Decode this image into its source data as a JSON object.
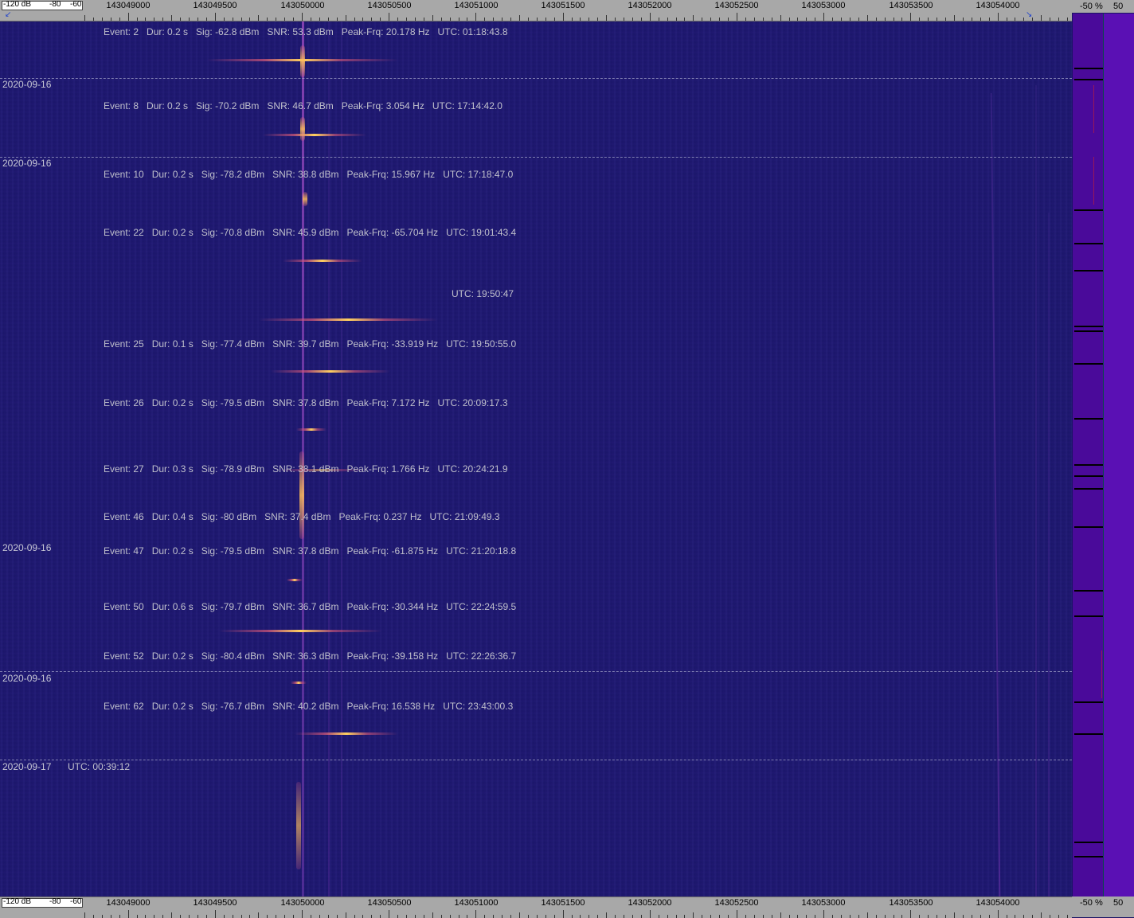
{
  "ruler": {
    "db_labels": [
      "-120 dB",
      "-80",
      "-60"
    ],
    "freqs": [
      "143049000",
      "143049500",
      "143050000",
      "143050500",
      "143051000",
      "143051500",
      "143052000",
      "143052500",
      "143053000",
      "143053500",
      "143054000"
    ]
  },
  "right_ruler": {
    "pct": "-50 %",
    "val": "50"
  },
  "dates": [
    {
      "text": "2020-09-16"
    },
    {
      "text": "2020-09-16"
    },
    {
      "text": "2020-09-16"
    },
    {
      "text": "2020-09-16"
    },
    {
      "text": "2020-09-17"
    }
  ],
  "events": [
    "Event: 2   Dur: 0.2 s   Sig: -62.8 dBm   SNR: 53.3 dBm   Peak-Frq: 20.178 Hz   UTC: 01:18:43.8",
    "Event: 8   Dur: 0.2 s   Sig: -70.2 dBm   SNR: 46.7 dBm   Peak-Frq: 3.054 Hz   UTC: 17:14:42.0",
    "Event: 10   Dur: 0.2 s   Sig: -78.2 dBm   SNR: 38.8 dBm   Peak-Frq: 15.967 Hz   UTC: 17:18:47.0",
    "Event: 22   Dur: 0.2 s   Sig: -70.8 dBm   SNR: 45.9 dBm   Peak-Frq: -65.704 Hz   UTC: 19:01:43.4",
    "Event: 25   Dur: 0.1 s   Sig: -77.4 dBm   SNR: 39.7 dBm   Peak-Frq: -33.919 Hz   UTC: 19:50:55.0",
    "Event: 26   Dur: 0.2 s   Sig: -79.5 dBm   SNR: 37.8 dBm   Peak-Frq: 7.172 Hz   UTC: 20:09:17.3",
    "Event: 27   Dur: 0.3 s   Sig: -78.9 dBm   SNR: 38.1 dBm   Peak-Frq: 1.766 Hz   UTC: 20:24:21.9",
    "Event: 46   Dur: 0.4 s   Sig: -80 dBm   SNR: 37.4 dBm   Peak-Frq: 0.237 Hz   UTC: 21:09:49.3",
    "Event: 47   Dur: 0.2 s   Sig: -79.5 dBm   SNR: 37.8 dBm   Peak-Frq: -61.875 Hz   UTC: 21:20:18.8",
    "Event: 50   Dur: 0.6 s   Sig: -79.7 dBm   SNR: 36.7 dBm   Peak-Frq: -30.344 Hz   UTC: 22:24:59.5",
    "Event: 52   Dur: 0.2 s   Sig: -80.4 dBm   SNR: 36.3 dBm   Peak-Frq: -39.158 Hz   UTC: 22:26:36.7",
    "Event: 62   Dur: 0.2 s   Sig: -76.7 dBm   SNR: 40.2 dBm   Peak-Frq: 16.538 Hz   UTC: 23:43:00.3"
  ],
  "utc_marks": [
    "UTC: 19:50:47",
    "UTC: 00:39:12"
  ]
}
